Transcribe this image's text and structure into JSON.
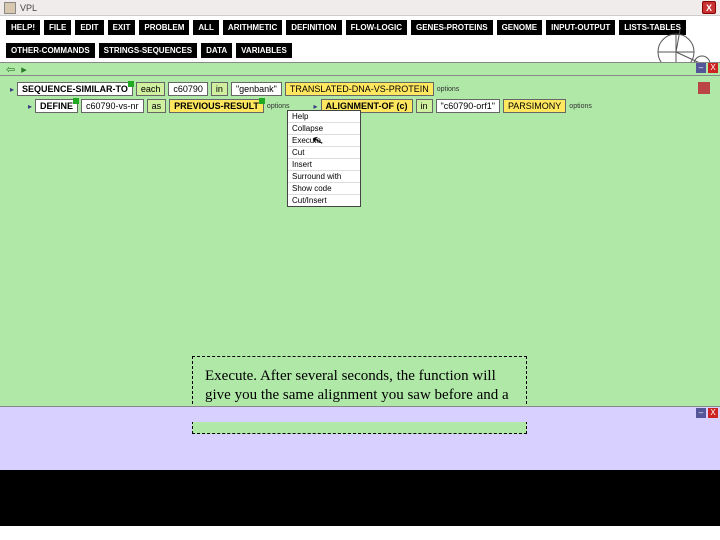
{
  "window": {
    "title": "VPL",
    "close": "X"
  },
  "toolbar_row1": [
    "HELP!",
    "FILE",
    "EDIT",
    "EXIT",
    "PROBLEM",
    "ALL",
    "ARITHMETIC",
    "DEFINITION",
    "FLOW-LOGIC",
    "GENES-PROTEINS",
    "GENOME",
    "INPUT-OUTPUT",
    "LISTS-TABLES"
  ],
  "toolbar_row2": [
    "OTHER-COMMANDS",
    "STRINGS-SEQUENCES",
    "DATA",
    "VARIABLES"
  ],
  "row1": {
    "fn": "SEQUENCE-SIMILAR-TO",
    "each": "each",
    "val": "c60790",
    "in": "in",
    "lit": "\"genbank\"",
    "trans": "TRANSLATED-DNA-VS-PROTEIN",
    "opt": "options"
  },
  "row2": {
    "fn": "DEFINE",
    "var": "c60790-vs-nr",
    "as": "as",
    "prev": "PREVIOUS-RESULT",
    "opt1": "options",
    "align": "ALIGNMENT-OF (c)",
    "in": "in",
    "lit": "\"c60790-orf1\"",
    "pars": "PARSIMONY",
    "opt2": "options"
  },
  "menu": {
    "items": [
      "Help",
      "Collapse",
      "Execute",
      "Cut",
      "Insert",
      "Surround with",
      "Show code",
      "Cut/Insert"
    ]
  },
  "note": "Execute. After several seconds, the function will give you the same alignment you saw before and a few seconds after that a tree."
}
